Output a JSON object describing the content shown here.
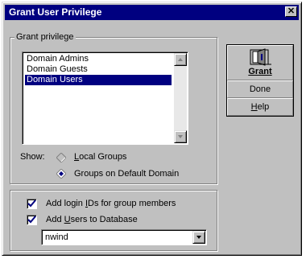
{
  "window": {
    "title": "Grant User Privilege",
    "close_glyph": "✕"
  },
  "privilege_group": {
    "legend": "Grant privilege",
    "list": {
      "items": [
        "Domain Admins",
        "Domain Guests",
        "Domain Users"
      ],
      "selected_index": 2
    },
    "show_label": "Show:",
    "radio_options": [
      {
        "accel": "L",
        "rest": "ocal Groups",
        "selected": false,
        "enabled": false
      },
      {
        "accel": "",
        "rest": "Groups on Default Domain",
        "selected": true,
        "enabled": true
      }
    ]
  },
  "options_group": {
    "checkboxes": [
      {
        "pre": "Add login ",
        "accel": "I",
        "post": "Ds for group members",
        "checked": true
      },
      {
        "pre": "Add ",
        "accel": "U",
        "post": "sers to Database",
        "checked": true
      }
    ],
    "database_select": {
      "value": "nwind"
    }
  },
  "buttons": {
    "grant_label": "Grant",
    "done_label": "Done",
    "help_accel": "H",
    "help_rest": "elp"
  },
  "icons": {
    "close": "close-icon",
    "grant": "door-icon",
    "scroll_up": "scroll-up-arrow-icon",
    "scroll_down": "scroll-down-arrow-icon",
    "dropdown": "dropdown-arrow-icon"
  },
  "colors": {
    "title_bar": "#000080",
    "face": "#c0c0c0",
    "selection": "#000080",
    "check": "#000080"
  }
}
